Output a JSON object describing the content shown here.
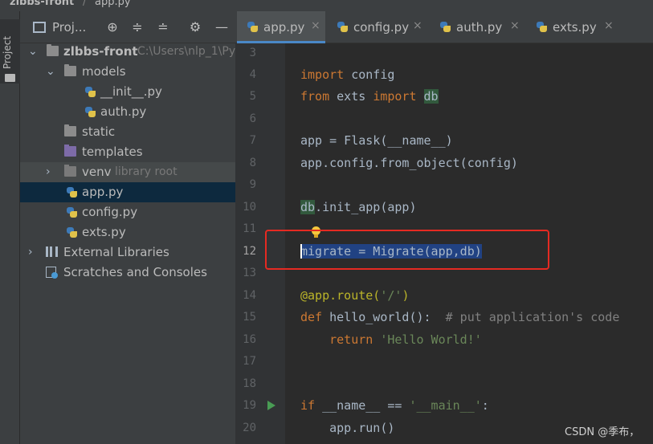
{
  "breadcrumb": {
    "project": "zlbbs-front",
    "separator": "/",
    "file": "app.py"
  },
  "toolstrip": {
    "project_tab": "Project"
  },
  "panel": {
    "title": "Proj...",
    "buttons": [
      "globe-icon",
      "collapse-all-icon",
      "expand-all-icon",
      "gear-icon",
      "minimize-icon"
    ]
  },
  "tree": [
    {
      "label": "zlbbs-front",
      "hint": "C:\\Users\\nlp_1\\Py",
      "icon": "folder-icon",
      "arrow": "down"
    },
    {
      "label": "models",
      "icon": "package-folder-icon",
      "arrow": "down"
    },
    {
      "label": "__init__.py",
      "icon": "python-file-icon"
    },
    {
      "label": "auth.py",
      "icon": "python-file-icon"
    },
    {
      "label": "static",
      "icon": "folder-icon"
    },
    {
      "label": "templates",
      "icon": "template-folder-icon"
    },
    {
      "label": "venv",
      "hint": "library root",
      "icon": "folder-icon",
      "arrow": "right"
    },
    {
      "label": "app.py",
      "icon": "python-file-icon",
      "selected": true
    },
    {
      "label": "config.py",
      "icon": "python-file-icon"
    },
    {
      "label": "exts.py",
      "icon": "python-file-icon"
    },
    {
      "label": "External Libraries",
      "icon": "libraries-icon",
      "arrow": "right"
    },
    {
      "label": "Scratches and Consoles",
      "icon": "scratches-icon"
    }
  ],
  "tabs": [
    {
      "label": "app.py",
      "active": true
    },
    {
      "label": "config.py"
    },
    {
      "label": "auth.py"
    },
    {
      "label": "exts.py"
    }
  ],
  "close_glyph": "×",
  "line_numbers": [
    "3",
    "4",
    "5",
    "6",
    "7",
    "8",
    "9",
    "10",
    "11",
    "12",
    "13",
    "14",
    "15",
    "16",
    "17",
    "18",
    "19",
    "20"
  ],
  "current_line": "12",
  "code": {
    "l4_kw": "import",
    "l4_rest": " config",
    "l5_kw1": "from",
    "l5_mid": " exts ",
    "l5_kw2": "import",
    "l5_sp": " ",
    "l5_db": "db",
    "l7": "app = Flask(__name__)",
    "l8": "app.config.from_object(config)",
    "l10_db": "db",
    "l10_rest": ".init_app(app)",
    "l12": "migrate = Migrate(app,db)",
    "l14_dec": "@app.route(",
    "l14_str": "'/'",
    "l14_end": ")",
    "l15_kw": "def",
    "l15_fn": " hello_world():  ",
    "l15_cmt": "# put application's code",
    "l16_indent": "    ",
    "l16_kw": "return",
    "l16_sp": " ",
    "l16_str": "'Hello World!'",
    "l19_kw": "if",
    "l19_mid": " __name__ == ",
    "l19_str": "'__main__'",
    "l19_end": ":",
    "l20": "    app.run()"
  },
  "watermark": "CSDN @季布，",
  "colors": {
    "keyword": "#cc7832",
    "string": "#6a8759",
    "decorator": "#bbb529",
    "comment": "#808080",
    "selection": "#214283",
    "annotation_box": "#e52a22"
  }
}
